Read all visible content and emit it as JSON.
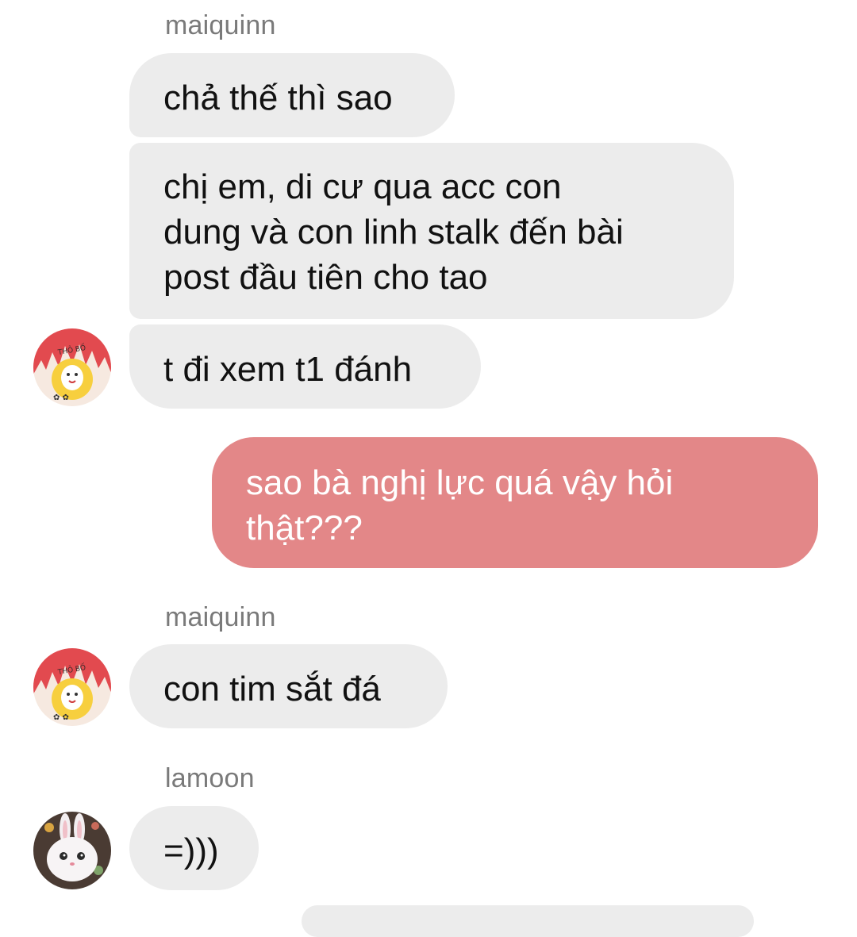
{
  "conversation": {
    "messages": [
      {
        "sender": "maiquinn",
        "text": "chả thế thì sao",
        "direction": "incoming"
      },
      {
        "text": "chị em, di cư qua acc con\ndung và con linh stalk đến bài\npost đầu tiên cho tao",
        "direction": "incoming"
      },
      {
        "text": "t đi xem t1 đánh",
        "direction": "incoming",
        "avatar": "maiquinn-avatar"
      },
      {
        "text": "sao bà nghị lực quá vậy hỏi\nthật???",
        "direction": "outgoing"
      },
      {
        "sender": "maiquinn",
        "text": "con tim sắt đá",
        "direction": "incoming",
        "avatar": "maiquinn-avatar"
      },
      {
        "sender": "lamoon",
        "text": "=)))",
        "direction": "incoming",
        "avatar": "lamoon-avatar"
      }
    ]
  },
  "colors": {
    "incoming_bubble": "#ececec",
    "outgoing_bubble": "#e38788",
    "sender_name": "#7a7a7a",
    "text": "#111111"
  },
  "icons": {
    "maiquinn_avatar": "cartoon-sticker-avatar",
    "lamoon_avatar": "bunny-avatar"
  }
}
